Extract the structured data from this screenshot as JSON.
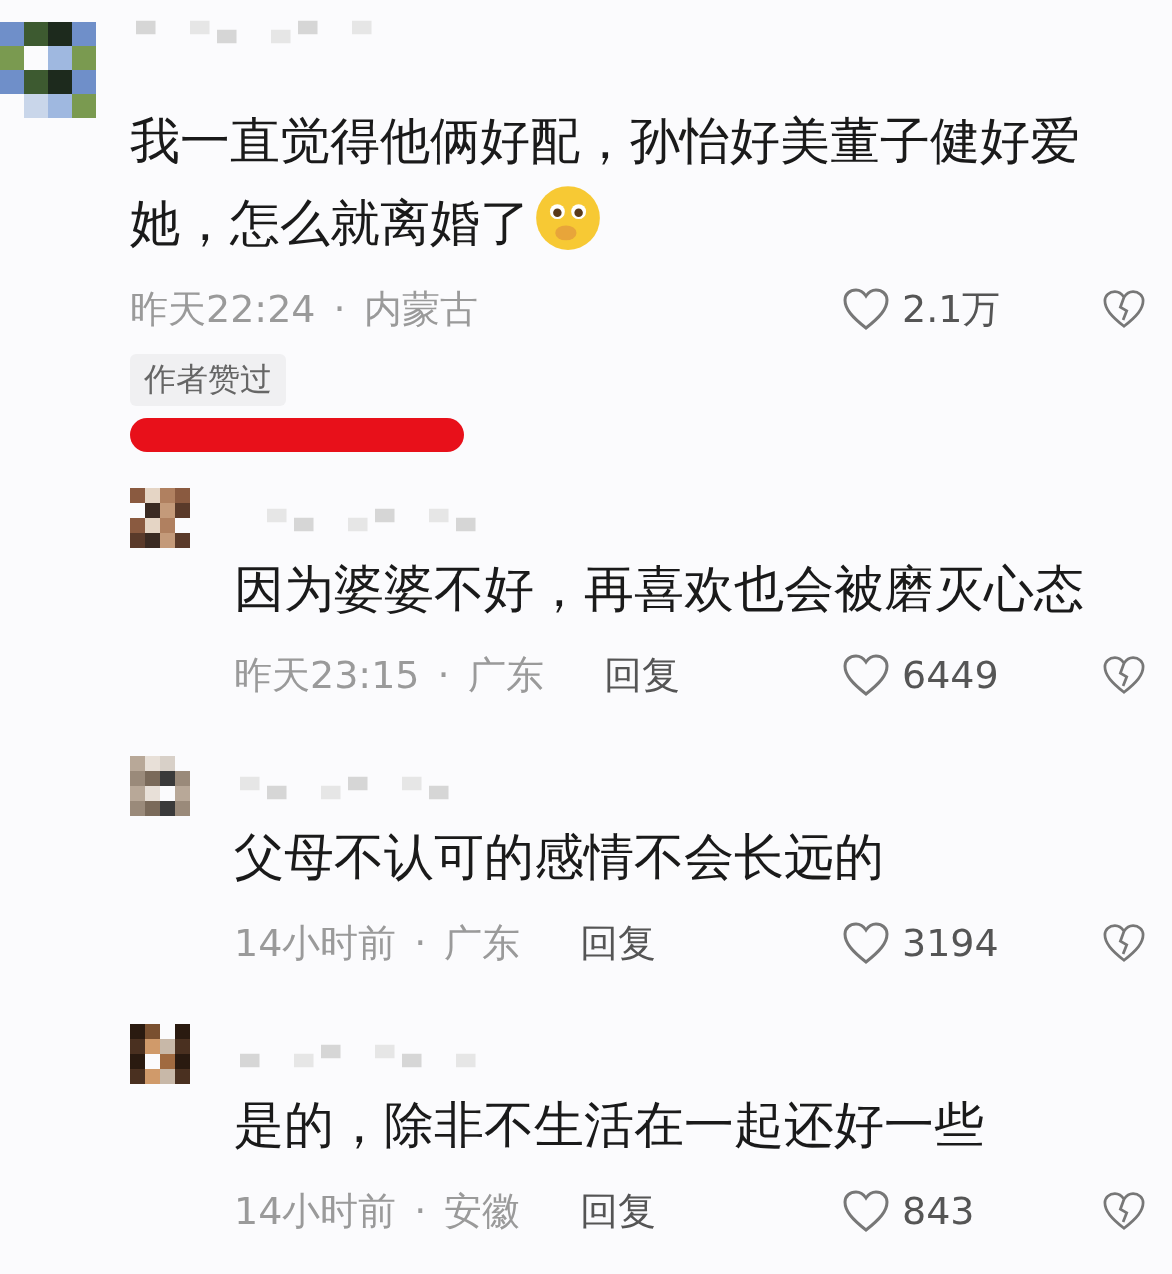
{
  "comments": [
    {
      "text": "我一直觉得他俩好配，孙怡好美董子健好爱她，怎么就离婚了",
      "emoji": true,
      "time": "昨天22:24",
      "separator": "·",
      "location": "内蒙古",
      "likes": "2.1万",
      "author_liked": true,
      "badge": "作者赞过",
      "replies": [
        {
          "text": "因为婆婆不好，再喜欢也会被磨灭心态",
          "time": "昨天23:15",
          "separator": "·",
          "location": "广东",
          "reply": "回复",
          "likes": "6449"
        },
        {
          "text": "父母不认可的感情不会长远的",
          "time": "14小时前",
          "separator": "·",
          "location": "广东",
          "reply": "回复",
          "likes": "3194"
        },
        {
          "text": "是的，除非不生活在一起还好一些",
          "time": "14小时前",
          "separator": "·",
          "location": "安徽",
          "reply": "回复",
          "likes": "843"
        }
      ]
    }
  ]
}
